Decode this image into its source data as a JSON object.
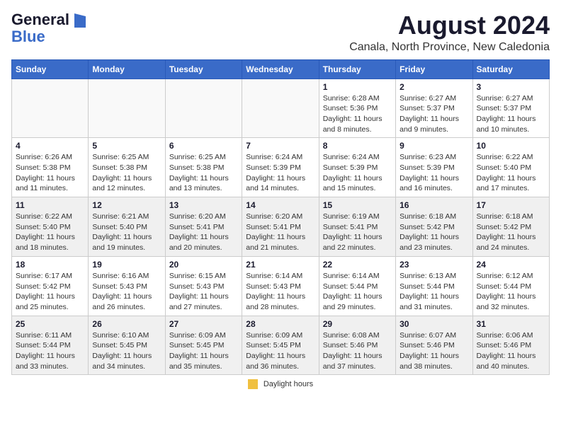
{
  "header": {
    "logo_general": "General",
    "logo_blue": "Blue",
    "month_title": "August 2024",
    "location": "Canala, North Province, New Caledonia"
  },
  "days_of_week": [
    "Sunday",
    "Monday",
    "Tuesday",
    "Wednesday",
    "Thursday",
    "Friday",
    "Saturday"
  ],
  "footer": {
    "legend_label": "Daylight hours"
  },
  "weeks": [
    {
      "alt": false,
      "days": [
        {
          "num": "",
          "info": ""
        },
        {
          "num": "",
          "info": ""
        },
        {
          "num": "",
          "info": ""
        },
        {
          "num": "",
          "info": ""
        },
        {
          "num": "1",
          "info": "Sunrise: 6:28 AM\nSunset: 5:36 PM\nDaylight: 11 hours and 8 minutes."
        },
        {
          "num": "2",
          "info": "Sunrise: 6:27 AM\nSunset: 5:37 PM\nDaylight: 11 hours and 9 minutes."
        },
        {
          "num": "3",
          "info": "Sunrise: 6:27 AM\nSunset: 5:37 PM\nDaylight: 11 hours and 10 minutes."
        }
      ]
    },
    {
      "alt": false,
      "days": [
        {
          "num": "4",
          "info": "Sunrise: 6:26 AM\nSunset: 5:38 PM\nDaylight: 11 hours and 11 minutes."
        },
        {
          "num": "5",
          "info": "Sunrise: 6:25 AM\nSunset: 5:38 PM\nDaylight: 11 hours and 12 minutes."
        },
        {
          "num": "6",
          "info": "Sunrise: 6:25 AM\nSunset: 5:38 PM\nDaylight: 11 hours and 13 minutes."
        },
        {
          "num": "7",
          "info": "Sunrise: 6:24 AM\nSunset: 5:39 PM\nDaylight: 11 hours and 14 minutes."
        },
        {
          "num": "8",
          "info": "Sunrise: 6:24 AM\nSunset: 5:39 PM\nDaylight: 11 hours and 15 minutes."
        },
        {
          "num": "9",
          "info": "Sunrise: 6:23 AM\nSunset: 5:39 PM\nDaylight: 11 hours and 16 minutes."
        },
        {
          "num": "10",
          "info": "Sunrise: 6:22 AM\nSunset: 5:40 PM\nDaylight: 11 hours and 17 minutes."
        }
      ]
    },
    {
      "alt": true,
      "days": [
        {
          "num": "11",
          "info": "Sunrise: 6:22 AM\nSunset: 5:40 PM\nDaylight: 11 hours and 18 minutes."
        },
        {
          "num": "12",
          "info": "Sunrise: 6:21 AM\nSunset: 5:40 PM\nDaylight: 11 hours and 19 minutes."
        },
        {
          "num": "13",
          "info": "Sunrise: 6:20 AM\nSunset: 5:41 PM\nDaylight: 11 hours and 20 minutes."
        },
        {
          "num": "14",
          "info": "Sunrise: 6:20 AM\nSunset: 5:41 PM\nDaylight: 11 hours and 21 minutes."
        },
        {
          "num": "15",
          "info": "Sunrise: 6:19 AM\nSunset: 5:41 PM\nDaylight: 11 hours and 22 minutes."
        },
        {
          "num": "16",
          "info": "Sunrise: 6:18 AM\nSunset: 5:42 PM\nDaylight: 11 hours and 23 minutes."
        },
        {
          "num": "17",
          "info": "Sunrise: 6:18 AM\nSunset: 5:42 PM\nDaylight: 11 hours and 24 minutes."
        }
      ]
    },
    {
      "alt": false,
      "days": [
        {
          "num": "18",
          "info": "Sunrise: 6:17 AM\nSunset: 5:42 PM\nDaylight: 11 hours and 25 minutes."
        },
        {
          "num": "19",
          "info": "Sunrise: 6:16 AM\nSunset: 5:43 PM\nDaylight: 11 hours and 26 minutes."
        },
        {
          "num": "20",
          "info": "Sunrise: 6:15 AM\nSunset: 5:43 PM\nDaylight: 11 hours and 27 minutes."
        },
        {
          "num": "21",
          "info": "Sunrise: 6:14 AM\nSunset: 5:43 PM\nDaylight: 11 hours and 28 minutes."
        },
        {
          "num": "22",
          "info": "Sunrise: 6:14 AM\nSunset: 5:44 PM\nDaylight: 11 hours and 29 minutes."
        },
        {
          "num": "23",
          "info": "Sunrise: 6:13 AM\nSunset: 5:44 PM\nDaylight: 11 hours and 31 minutes."
        },
        {
          "num": "24",
          "info": "Sunrise: 6:12 AM\nSunset: 5:44 PM\nDaylight: 11 hours and 32 minutes."
        }
      ]
    },
    {
      "alt": true,
      "days": [
        {
          "num": "25",
          "info": "Sunrise: 6:11 AM\nSunset: 5:44 PM\nDaylight: 11 hours and 33 minutes."
        },
        {
          "num": "26",
          "info": "Sunrise: 6:10 AM\nSunset: 5:45 PM\nDaylight: 11 hours and 34 minutes."
        },
        {
          "num": "27",
          "info": "Sunrise: 6:09 AM\nSunset: 5:45 PM\nDaylight: 11 hours and 35 minutes."
        },
        {
          "num": "28",
          "info": "Sunrise: 6:09 AM\nSunset: 5:45 PM\nDaylight: 11 hours and 36 minutes."
        },
        {
          "num": "29",
          "info": "Sunrise: 6:08 AM\nSunset: 5:46 PM\nDaylight: 11 hours and 37 minutes."
        },
        {
          "num": "30",
          "info": "Sunrise: 6:07 AM\nSunset: 5:46 PM\nDaylight: 11 hours and 38 minutes."
        },
        {
          "num": "31",
          "info": "Sunrise: 6:06 AM\nSunset: 5:46 PM\nDaylight: 11 hours and 40 minutes."
        }
      ]
    }
  ]
}
